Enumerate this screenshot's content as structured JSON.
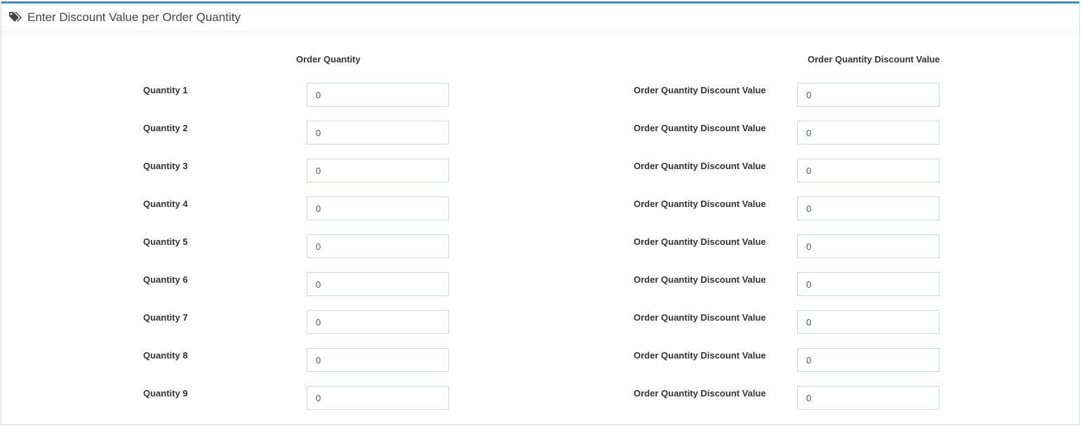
{
  "panel": {
    "title": "Enter Discount Value per Order Quantity",
    "icon": "tags-icon",
    "accent_color": "#3c8dbc"
  },
  "columns": {
    "left_header": "Order Quantity",
    "right_header": "Order Quantity Discount Value"
  },
  "rows": [
    {
      "quantity_label": "Quantity 1",
      "quantity_value": "0",
      "discount_label": "Order Quantity Discount Value",
      "discount_value": "0"
    },
    {
      "quantity_label": "Quantity 2",
      "quantity_value": "0",
      "discount_label": "Order Quantity Discount Value",
      "discount_value": "0"
    },
    {
      "quantity_label": "Quantity 3",
      "quantity_value": "0",
      "discount_label": "Order Quantity Discount Value",
      "discount_value": "0"
    },
    {
      "quantity_label": "Quantity 4",
      "quantity_value": "0",
      "discount_label": "Order Quantity Discount Value",
      "discount_value": "0"
    },
    {
      "quantity_label": "Quantity 5",
      "quantity_value": "0",
      "discount_label": "Order Quantity Discount Value",
      "discount_value": "0"
    },
    {
      "quantity_label": "Quantity 6",
      "quantity_value": "0",
      "discount_label": "Order Quantity Discount Value",
      "discount_value": "0"
    },
    {
      "quantity_label": "Quantity 7",
      "quantity_value": "0",
      "discount_label": "Order Quantity Discount Value",
      "discount_value": "0"
    },
    {
      "quantity_label": "Quantity 8",
      "quantity_value": "0",
      "discount_label": "Order Quantity Discount Value",
      "discount_value": "0"
    },
    {
      "quantity_label": "Quantity 9",
      "quantity_value": "0",
      "discount_label": "Order Quantity Discount Value",
      "discount_value": "0"
    }
  ]
}
